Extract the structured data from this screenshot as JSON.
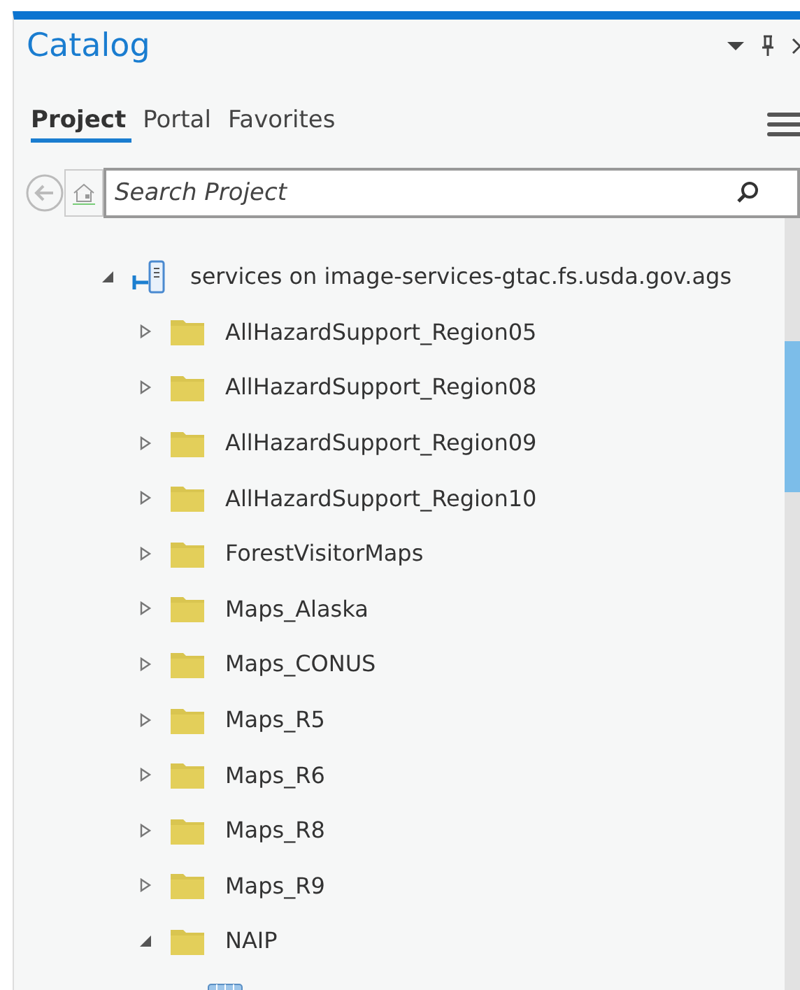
{
  "pane": {
    "title": "Catalog"
  },
  "tabs": [
    {
      "label": "Project",
      "selected": true
    },
    {
      "label": "Portal",
      "selected": false
    },
    {
      "label": "Favorites",
      "selected": false
    }
  ],
  "search": {
    "placeholder": "Search Project"
  },
  "tree": [
    {
      "label": "services on image-services-gtac.fs.usda.gov.ags",
      "kind": "server",
      "expanded": true,
      "children": [
        {
          "label": "AllHazardSupport_Region05",
          "kind": "folder",
          "expanded": false
        },
        {
          "label": "AllHazardSupport_Region08",
          "kind": "folder",
          "expanded": false
        },
        {
          "label": "AllHazardSupport_Region09",
          "kind": "folder",
          "expanded": false
        },
        {
          "label": "AllHazardSupport_Region10",
          "kind": "folder",
          "expanded": false
        },
        {
          "label": "ForestVisitorMaps",
          "kind": "folder",
          "expanded": false
        },
        {
          "label": "Maps_Alaska",
          "kind": "folder",
          "expanded": false
        },
        {
          "label": "Maps_CONUS",
          "kind": "folder",
          "expanded": false
        },
        {
          "label": "Maps_R5",
          "kind": "folder",
          "expanded": false
        },
        {
          "label": "Maps_R6",
          "kind": "folder",
          "expanded": false
        },
        {
          "label": "Maps_R8",
          "kind": "folder",
          "expanded": false
        },
        {
          "label": "Maps_R9",
          "kind": "folder",
          "expanded": false
        },
        {
          "label": "NAIP",
          "kind": "folder",
          "expanded": true,
          "children": [
            {
              "kind": "imagery"
            }
          ]
        }
      ]
    }
  ]
}
